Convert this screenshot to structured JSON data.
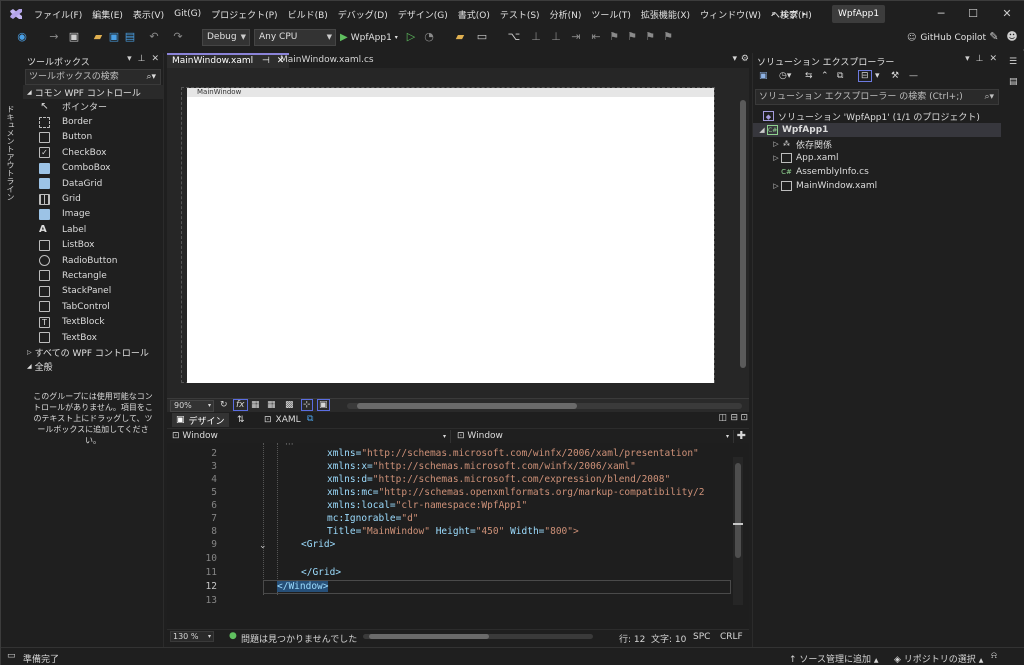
{
  "menubar": {
    "items": [
      "ファイル(F)",
      "編集(E)",
      "表示(V)",
      "Git(G)",
      "プロジェクト(P)",
      "ビルド(B)",
      "デバッグ(D)",
      "デザイン(G)",
      "書式(O)",
      "テスト(S)",
      "分析(N)",
      "ツール(T)",
      "拡張機能(X)",
      "ウィンドウ(W)",
      "ヘルプ(H)"
    ],
    "search_label": "検索",
    "app_name": "WpfApp1"
  },
  "toolbar": {
    "config": "Debug",
    "platform": "Any CPU",
    "run_target": "WpfApp1",
    "copilot_label": "GitHub Copilot"
  },
  "left_vertical_tab": "ドキュメントアウトライン",
  "toolbox": {
    "title": "ツールボックス",
    "search_placeholder": "ツールボックスの検索",
    "group_common": "コモン WPF コントロール",
    "items": [
      "ポインター",
      "Border",
      "Button",
      "CheckBox",
      "ComboBox",
      "DataGrid",
      "Grid",
      "Image",
      "Label",
      "ListBox",
      "RadioButton",
      "Rectangle",
      "StackPanel",
      "TabControl",
      "TextBlock",
      "TextBox"
    ],
    "group_all": "すべての WPF コントロール",
    "group_general": "全般",
    "empty_message": "このグループには使用可能なコントロールがありません。項目をこのテキスト上にドラッグして、ツールボックスに追加してください。"
  },
  "document": {
    "tabs": [
      "MainWindow.xaml",
      "MainWindow.xaml.cs"
    ],
    "designer_window_title": "MainWindow",
    "zoom": "90%",
    "split_tabs": {
      "design": "デザイン",
      "xaml": "XAML"
    },
    "nav_left": "Window",
    "nav_right": "Window"
  },
  "editor": {
    "line_numbers": [
      "2",
      "3",
      "4",
      "5",
      "6",
      "7",
      "8",
      "9",
      "10",
      "11",
      "12",
      "13"
    ],
    "lines": [
      {
        "a": "xmlns=",
        "b": "\"http://schemas.microsoft.com/winfx/2006/xaml/presentation\""
      },
      {
        "a": "xmlns:x=",
        "b": "\"http://schemas.microsoft.com/winfx/2006/xaml\""
      },
      {
        "a": "xmlns:d=",
        "b": "\"http://schemas.microsoft.com/expression/blend/2008\""
      },
      {
        "a": "xmlns:mc=",
        "b": "\"http://schemas.openxmlformats.org/markup-compatibility/2"
      },
      {
        "a": "xmlns:local=",
        "b": "\"clr-namespace:WpfApp1\""
      },
      {
        "a": "mc:Ignorable=",
        "b": "\"d\""
      },
      {
        "a": "Title=",
        "b": "\"MainWindow\"",
        "c": " Height=",
        "d": "\"450\"",
        "e": " Width=",
        "f": "\"800\">"
      },
      {
        "a": "<Grid>"
      },
      {
        "a": ""
      },
      {
        "a": "</Grid>"
      },
      {
        "a": "</Window>"
      },
      {
        "a": ""
      }
    ],
    "zoom": "130 %",
    "issues": "問題は見つかりませんでした",
    "line_label": "行: 12",
    "char_label": "文字: 10",
    "spc": "SPC",
    "crlf": "CRLF"
  },
  "solution": {
    "title": "ソリューション エクスプローラー",
    "search_placeholder": "ソリューション エクスプローラー の検索 (Ctrl+;)",
    "solution_node": "ソリューション 'WpfApp1' (1/1 のプロジェクト)",
    "project_node": "WpfApp1",
    "children": [
      "依存関係",
      "App.xaml",
      "AssemblyInfo.cs",
      "MainWindow.xaml"
    ]
  },
  "statusbar": {
    "ready": "準備完了",
    "source_control": "ソース管理に追加",
    "repo": "リポジトリの選択"
  }
}
